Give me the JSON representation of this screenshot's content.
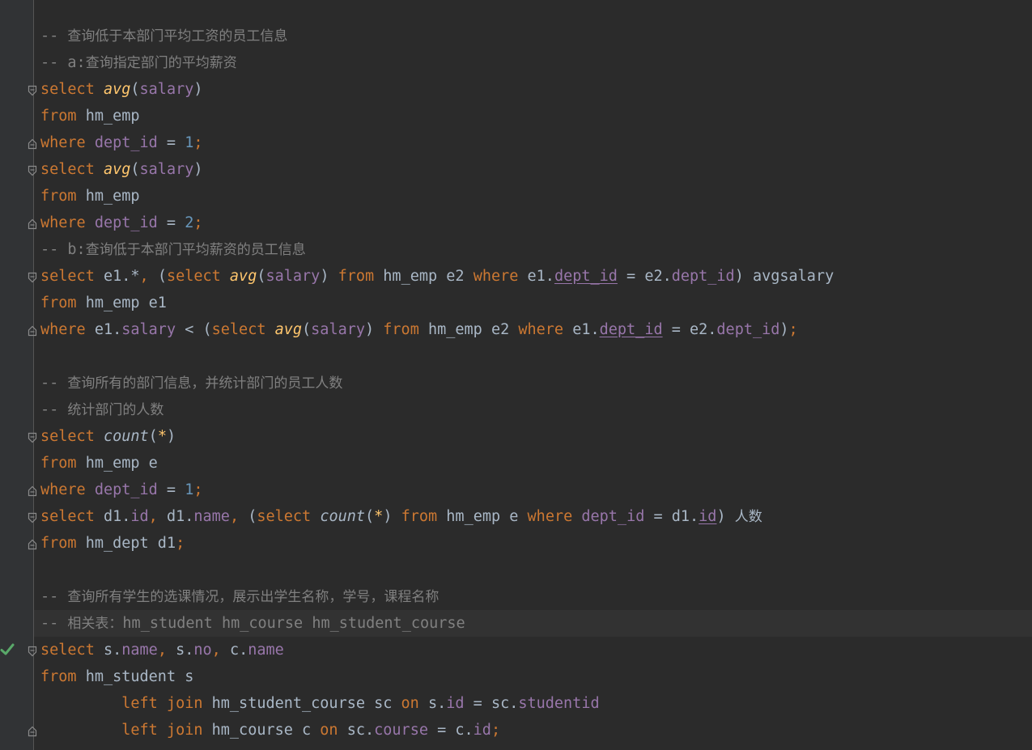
{
  "editor": {
    "lines": [
      {
        "fold": null,
        "tokens": [
          {
            "t": "-- ",
            "c": "cm"
          },
          {
            "t": "查询低于本部门平均工资的员工信息",
            "c": "cm-cjk"
          }
        ]
      },
      {
        "fold": null,
        "tokens": [
          {
            "t": "-- a:",
            "c": "cm"
          },
          {
            "t": "查询指定部门的平均薪资",
            "c": "cm-cjk"
          }
        ]
      },
      {
        "fold": "start",
        "tokens": [
          {
            "t": "select ",
            "c": "kw"
          },
          {
            "t": "avg",
            "c": "fn"
          },
          {
            "t": "(",
            "c": "p"
          },
          {
            "t": "salary",
            "c": "col"
          },
          {
            "t": ")",
            "c": "p"
          }
        ]
      },
      {
        "fold": null,
        "tokens": [
          {
            "t": "from ",
            "c": "kw"
          },
          {
            "t": "hm_emp",
            "c": "p"
          }
        ]
      },
      {
        "fold": "end",
        "tokens": [
          {
            "t": "where ",
            "c": "kw"
          },
          {
            "t": "dept_id",
            "c": "col"
          },
          {
            "t": " = ",
            "c": "p"
          },
          {
            "t": "1",
            "c": "num"
          },
          {
            "t": ";",
            "c": "semi"
          }
        ]
      },
      {
        "fold": "start",
        "tokens": [
          {
            "t": "select ",
            "c": "kw"
          },
          {
            "t": "avg",
            "c": "fn"
          },
          {
            "t": "(",
            "c": "p"
          },
          {
            "t": "salary",
            "c": "col"
          },
          {
            "t": ")",
            "c": "p"
          }
        ]
      },
      {
        "fold": null,
        "tokens": [
          {
            "t": "from ",
            "c": "kw"
          },
          {
            "t": "hm_emp",
            "c": "p"
          }
        ]
      },
      {
        "fold": "end",
        "tokens": [
          {
            "t": "where ",
            "c": "kw"
          },
          {
            "t": "dept_id",
            "c": "col"
          },
          {
            "t": " = ",
            "c": "p"
          },
          {
            "t": "2",
            "c": "num"
          },
          {
            "t": ";",
            "c": "semi"
          }
        ]
      },
      {
        "fold": null,
        "tokens": [
          {
            "t": "-- b:",
            "c": "cm"
          },
          {
            "t": "查询低于本部门平均薪资的员工信息",
            "c": "cm-cjk"
          }
        ]
      },
      {
        "fold": "start",
        "tokens": [
          {
            "t": "select ",
            "c": "kw"
          },
          {
            "t": "e1.*",
            "c": "p"
          },
          {
            "t": ", ",
            "c": "semi"
          },
          {
            "t": "(",
            "c": "p"
          },
          {
            "t": "select ",
            "c": "kw"
          },
          {
            "t": "avg",
            "c": "fn"
          },
          {
            "t": "(",
            "c": "p"
          },
          {
            "t": "salary",
            "c": "col"
          },
          {
            "t": ") ",
            "c": "p"
          },
          {
            "t": "from ",
            "c": "kw"
          },
          {
            "t": "hm_emp e2 ",
            "c": "p"
          },
          {
            "t": "where ",
            "c": "kw"
          },
          {
            "t": "e1.",
            "c": "p"
          },
          {
            "t": "dept_id",
            "c": "colu"
          },
          {
            "t": " = e2.",
            "c": "p"
          },
          {
            "t": "dept_id",
            "c": "col"
          },
          {
            "t": ") avgsalary",
            "c": "p"
          }
        ]
      },
      {
        "fold": null,
        "tokens": [
          {
            "t": "from ",
            "c": "kw"
          },
          {
            "t": "hm_emp e1",
            "c": "p"
          }
        ]
      },
      {
        "fold": "end",
        "tokens": [
          {
            "t": "where ",
            "c": "kw"
          },
          {
            "t": "e1.",
            "c": "p"
          },
          {
            "t": "salary",
            "c": "col"
          },
          {
            "t": " < (",
            "c": "p"
          },
          {
            "t": "select ",
            "c": "kw"
          },
          {
            "t": "avg",
            "c": "fn"
          },
          {
            "t": "(",
            "c": "p"
          },
          {
            "t": "salary",
            "c": "col"
          },
          {
            "t": ") ",
            "c": "p"
          },
          {
            "t": "from ",
            "c": "kw"
          },
          {
            "t": "hm_emp e2 ",
            "c": "p"
          },
          {
            "t": "where ",
            "c": "kw"
          },
          {
            "t": "e1.",
            "c": "p"
          },
          {
            "t": "dept_id",
            "c": "colu"
          },
          {
            "t": " = e2.",
            "c": "p"
          },
          {
            "t": "dept_id",
            "c": "col"
          },
          {
            "t": ")",
            "c": "p"
          },
          {
            "t": ";",
            "c": "semi"
          }
        ]
      },
      {
        "fold": null,
        "tokens": []
      },
      {
        "fold": null,
        "tokens": [
          {
            "t": "-- ",
            "c": "cm"
          },
          {
            "t": "查询所有的部门信息，并统计部门的员工人数",
            "c": "cm-cjk"
          }
        ]
      },
      {
        "fold": null,
        "tokens": [
          {
            "t": "-- ",
            "c": "cm"
          },
          {
            "t": "统计部门的人数",
            "c": "cm-cjk"
          }
        ]
      },
      {
        "fold": "start",
        "tokens": [
          {
            "t": "select ",
            "c": "kw"
          },
          {
            "t": "count",
            "c": "fnp"
          },
          {
            "t": "(",
            "c": "p"
          },
          {
            "t": "*",
            "c": "star"
          },
          {
            "t": ")",
            "c": "p"
          }
        ]
      },
      {
        "fold": null,
        "tokens": [
          {
            "t": "from ",
            "c": "kw"
          },
          {
            "t": "hm_emp e",
            "c": "p"
          }
        ]
      },
      {
        "fold": "end",
        "tokens": [
          {
            "t": "where ",
            "c": "kw"
          },
          {
            "t": "dept_id",
            "c": "col"
          },
          {
            "t": " = ",
            "c": "p"
          },
          {
            "t": "1",
            "c": "num"
          },
          {
            "t": ";",
            "c": "semi"
          }
        ]
      },
      {
        "fold": "start",
        "tokens": [
          {
            "t": "select ",
            "c": "kw"
          },
          {
            "t": "d1.",
            "c": "p"
          },
          {
            "t": "id",
            "c": "col"
          },
          {
            "t": ", ",
            "c": "semi"
          },
          {
            "t": "d1.",
            "c": "p"
          },
          {
            "t": "name",
            "c": "col"
          },
          {
            "t": ", ",
            "c": "semi"
          },
          {
            "t": "(",
            "c": "p"
          },
          {
            "t": "select ",
            "c": "kw"
          },
          {
            "t": "count",
            "c": "fnp"
          },
          {
            "t": "(",
            "c": "p"
          },
          {
            "t": "*",
            "c": "star"
          },
          {
            "t": ") ",
            "c": "p"
          },
          {
            "t": "from ",
            "c": "kw"
          },
          {
            "t": "hm_emp e ",
            "c": "p"
          },
          {
            "t": "where ",
            "c": "kw"
          },
          {
            "t": "dept_id",
            "c": "col"
          },
          {
            "t": " = d1.",
            "c": "p"
          },
          {
            "t": "id",
            "c": "colu"
          },
          {
            "t": ") ",
            "c": "p"
          },
          {
            "t": "人数",
            "c": "cjk"
          }
        ]
      },
      {
        "fold": "end",
        "tokens": [
          {
            "t": "from ",
            "c": "kw"
          },
          {
            "t": "hm_dept d1",
            "c": "p"
          },
          {
            "t": ";",
            "c": "semi"
          }
        ]
      },
      {
        "fold": null,
        "tokens": []
      },
      {
        "fold": null,
        "tokens": [
          {
            "t": "-- ",
            "c": "cm"
          },
          {
            "t": "查询所有学生的选课情况，展示出学生名称，学号，课程名称",
            "c": "cm-cjk"
          }
        ]
      },
      {
        "fold": null,
        "current": true,
        "tokens": [
          {
            "t": "-- ",
            "c": "cm"
          },
          {
            "t": "相关表：",
            "c": "cm-cjk"
          },
          {
            "t": "hm_student hm_course hm_student_course",
            "c": "cm"
          }
        ]
      },
      {
        "fold": "start",
        "check": true,
        "tokens": [
          {
            "t": "select ",
            "c": "kw"
          },
          {
            "t": "s.",
            "c": "p"
          },
          {
            "t": "name",
            "c": "col"
          },
          {
            "t": ", ",
            "c": "semi"
          },
          {
            "t": "s.",
            "c": "p"
          },
          {
            "t": "no",
            "c": "col"
          },
          {
            "t": ", ",
            "c": "semi"
          },
          {
            "t": "c.",
            "c": "p"
          },
          {
            "t": "name",
            "c": "col"
          }
        ]
      },
      {
        "fold": null,
        "tokens": [
          {
            "t": "from ",
            "c": "kw"
          },
          {
            "t": "hm_student s",
            "c": "p"
          }
        ]
      },
      {
        "fold": null,
        "tokens": [
          {
            "t": "         ",
            "c": "p"
          },
          {
            "t": "left join ",
            "c": "kw"
          },
          {
            "t": "hm_student_course sc ",
            "c": "p"
          },
          {
            "t": "on ",
            "c": "kw"
          },
          {
            "t": "s.",
            "c": "p"
          },
          {
            "t": "id",
            "c": "col"
          },
          {
            "t": " = sc.",
            "c": "p"
          },
          {
            "t": "studentid",
            "c": "col"
          }
        ]
      },
      {
        "fold": "end",
        "tokens": [
          {
            "t": "         ",
            "c": "p"
          },
          {
            "t": "left join ",
            "c": "kw"
          },
          {
            "t": "hm_course c ",
            "c": "p"
          },
          {
            "t": "on ",
            "c": "kw"
          },
          {
            "t": "sc.",
            "c": "p"
          },
          {
            "t": "course",
            "c": "col"
          },
          {
            "t": " = c.",
            "c": "p"
          },
          {
            "t": "id",
            "c": "col"
          },
          {
            "t": ";",
            "c": "semi"
          }
        ]
      }
    ]
  }
}
